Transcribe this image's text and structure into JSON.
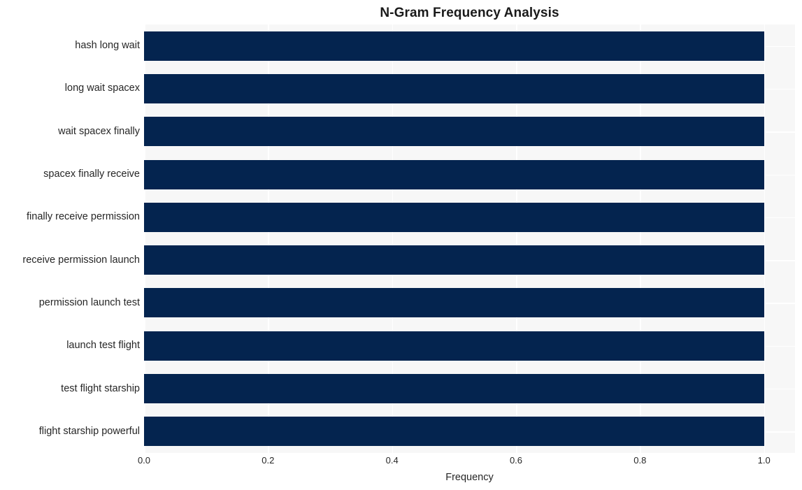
{
  "chart_data": {
    "type": "bar",
    "orientation": "horizontal",
    "title": "N-Gram Frequency Analysis",
    "xlabel": "Frequency",
    "ylabel": "",
    "categories": [
      "hash long wait",
      "long wait spacex",
      "wait spacex finally",
      "spacex finally receive",
      "finally receive permission",
      "receive permission launch",
      "permission launch test",
      "launch test flight",
      "test flight starship",
      "flight starship powerful"
    ],
    "values": [
      1.0,
      1.0,
      1.0,
      1.0,
      1.0,
      1.0,
      1.0,
      1.0,
      1.0,
      1.0
    ],
    "xlim": [
      0.0,
      1.05
    ],
    "xticks": [
      0.0,
      0.2,
      0.4,
      0.6,
      0.8,
      1.0
    ],
    "xticklabels": [
      "0.0",
      "0.2",
      "0.4",
      "0.6",
      "0.8",
      "1.0"
    ],
    "grid": true,
    "legend": null,
    "bar_color": "#04244f",
    "plot_background": "#f7f7f7",
    "figure_background": "#ffffff",
    "gridline_color": "#ffffff"
  }
}
